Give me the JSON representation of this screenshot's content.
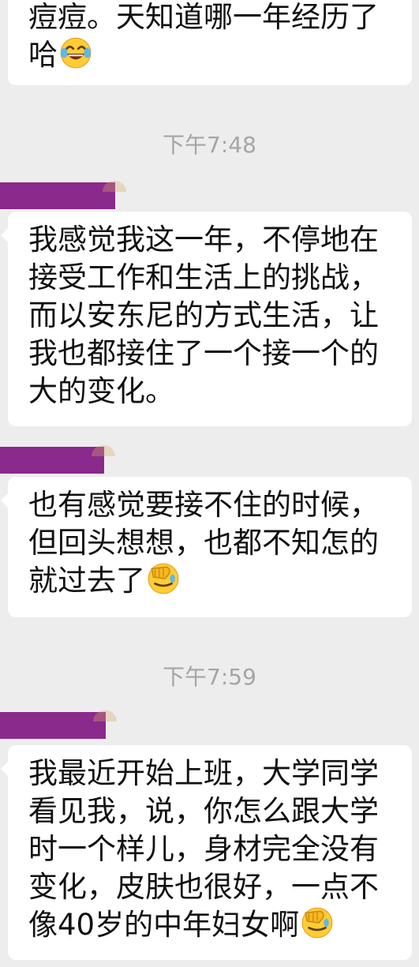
{
  "messages": [
    {
      "text": "痘痘。天知道哪一年经历了哈",
      "emoji": "laughing-tears"
    },
    {
      "text": "我感觉我这一年，不停地在接受工作和生活上的挑战，而以安东尼的方式生活，让我也都接住了一个接一个的大的变化。"
    },
    {
      "text": "也有感觉要接不住的时候，但回头想想，也都不知怎的就过去了",
      "emoji": "facepalm"
    },
    {
      "text": "我最近开始上班，大学同学看见我，说，你怎么跟大学时一个样儿，身材完全没有变化，皮肤也很好，一点不像40岁的中年妇女啊",
      "emoji": "facepalm"
    }
  ],
  "timestamps": [
    "下午7:48",
    "下午7:59"
  ],
  "colors": {
    "background": "#ededed",
    "bubble": "#ffffff",
    "redaction": "#8a2a8c",
    "timestamp_text": "#a5a5a5"
  }
}
